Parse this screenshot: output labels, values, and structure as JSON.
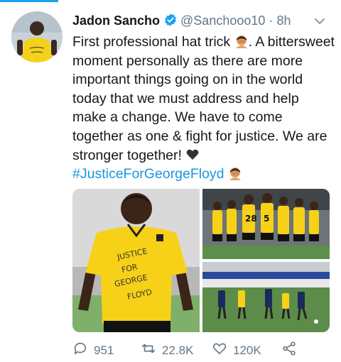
{
  "tweet": {
    "author_name": "Jadon Sancho",
    "handle": "@Sanchooo10",
    "separator": "·",
    "time": "8h",
    "text_line1": "First professional hat trick",
    "text_line1_tail": ". A bittersweet moment personally as there are more important things going on in the world today that we must address and help make a change. We have to come together as one & fight for justice. We are stronger together!",
    "hashtag": "#JusticeForGeorgeFloyd",
    "shirt_text": "JUSTICE FOR GEORGE FLOYD"
  },
  "actions": {
    "replies": "951",
    "retweets": "22.8K",
    "likes": "120K"
  },
  "icons": [
    "verified-badge-icon",
    "chevron-down-icon",
    "reply-icon",
    "retweet-icon",
    "like-icon",
    "share-icon"
  ],
  "colors": {
    "accent": "#1da1f2",
    "hashtag": "#1b95e0",
    "muted": "#657786",
    "kit_yellow": "#f7d117"
  }
}
